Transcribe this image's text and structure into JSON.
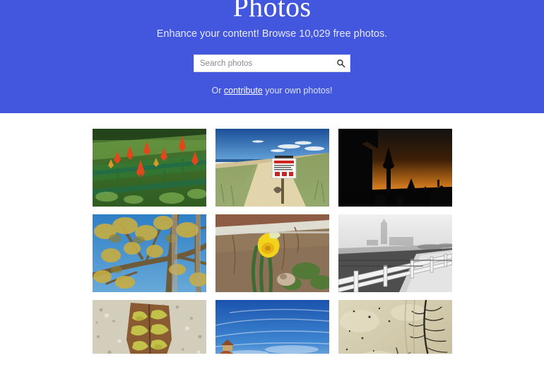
{
  "theme": {
    "brand_blue": "#4257dd",
    "page_background": "#ffffff",
    "link_color": "#ffffff",
    "subtitle_color": "#e6e9fb"
  },
  "hero": {
    "title": "Photos",
    "subtitle": "Enhance your content! Browse 10,029 free photos.",
    "photo_count": "10,029",
    "search": {
      "placeholder": "Search photos",
      "value": "",
      "icon": "search-icon"
    },
    "contribute": {
      "prefix": "Or ",
      "link_label": "contribute",
      "suffix": " your own photos!"
    }
  },
  "gallery": {
    "columns": 3,
    "rows_visible": 3,
    "items": [
      {
        "id": "photo-1",
        "alt": "Orange tropical heliconia flowers in a green garden bed",
        "palette": [
          "#2f5d22",
          "#e0481b",
          "#7fae4a",
          "#1d3d18",
          "#8fbf5a"
        ]
      },
      {
        "id": "photo-2",
        "alt": "Sandy dune path to the ocean with an AREA CLOSED sign",
        "palette": [
          "#2a5fa8",
          "#d8c79a",
          "#7d9a57",
          "#ffffff",
          "#1f4a86"
        ]
      },
      {
        "id": "photo-3",
        "alt": "Dark silhouette of temple roofs and a tower at orange sunset",
        "palette": [
          "#0a0a0a",
          "#e8821e",
          "#5c2f08",
          "#1a1208",
          "#f0a03a"
        ]
      },
      {
        "id": "photo-4",
        "alt": "Autumn tree branches with yellow leaves against a blue sky",
        "palette": [
          "#3f8fd6",
          "#b9a24a",
          "#6d5b3a",
          "#d8cf9a",
          "#2a6fb0"
        ]
      },
      {
        "id": "photo-5",
        "alt": "Single yellow daffodil blooming in a garden bed",
        "palette": [
          "#f2d21a",
          "#3f6b32",
          "#8c6b4f",
          "#b5a391",
          "#d8d8d0"
        ]
      },
      {
        "id": "photo-6",
        "alt": "Black and white foggy marsh with a wooden fence and lighthouse",
        "palette": [
          "#e9e9e9",
          "#6e6e6e",
          "#2f2f2f",
          "#c4c4c4",
          "#9a9a9a"
        ]
      },
      {
        "id": "photo-7",
        "alt": "Brown and yellow fallen leaf lying on speckled concrete",
        "palette": [
          "#cfcabc",
          "#8a5a32",
          "#c2c24a",
          "#e3e0d6",
          "#6b452a"
        ]
      },
      {
        "id": "photo-8",
        "alt": "Blue sky with wispy clouds above red tiled rooftops",
        "palette": [
          "#1f5fbe",
          "#8fb8e2",
          "#a8552c",
          "#d9c38f",
          "#2f7ad0"
        ]
      },
      {
        "id": "photo-9",
        "alt": "Branching rivulet patterns etched in pale beach sand",
        "palette": [
          "#d6cfb4",
          "#bdb498",
          "#3a3428",
          "#e6e0c8",
          "#8c8470"
        ]
      }
    ]
  }
}
